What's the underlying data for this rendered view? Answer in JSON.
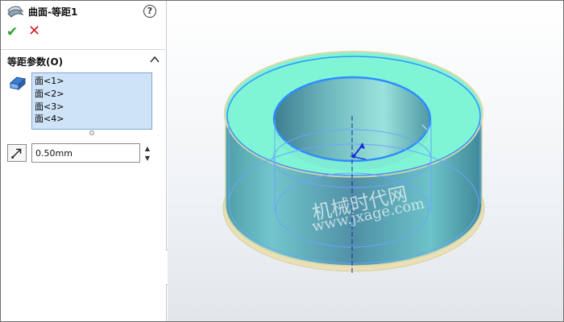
{
  "panel": {
    "title": "曲面-等距1",
    "help_symbol": "?",
    "ok_symbol": "✔",
    "cancel_symbol": "✕",
    "group": {
      "title": "等距参数(O)"
    },
    "faces": [
      "面<1>",
      "面<2>",
      "面<3>",
      "面<4>"
    ],
    "distance_value": "0.50mm",
    "spin_up": "▲",
    "spin_down": "▼"
  },
  "watermark": {
    "line1": "机械时代网",
    "line2": "www.jxage.com"
  },
  "colors": {
    "model_top": "#7ff5d6",
    "model_side": "#5fa9b4",
    "edge_highlight": "#2f8cff"
  }
}
